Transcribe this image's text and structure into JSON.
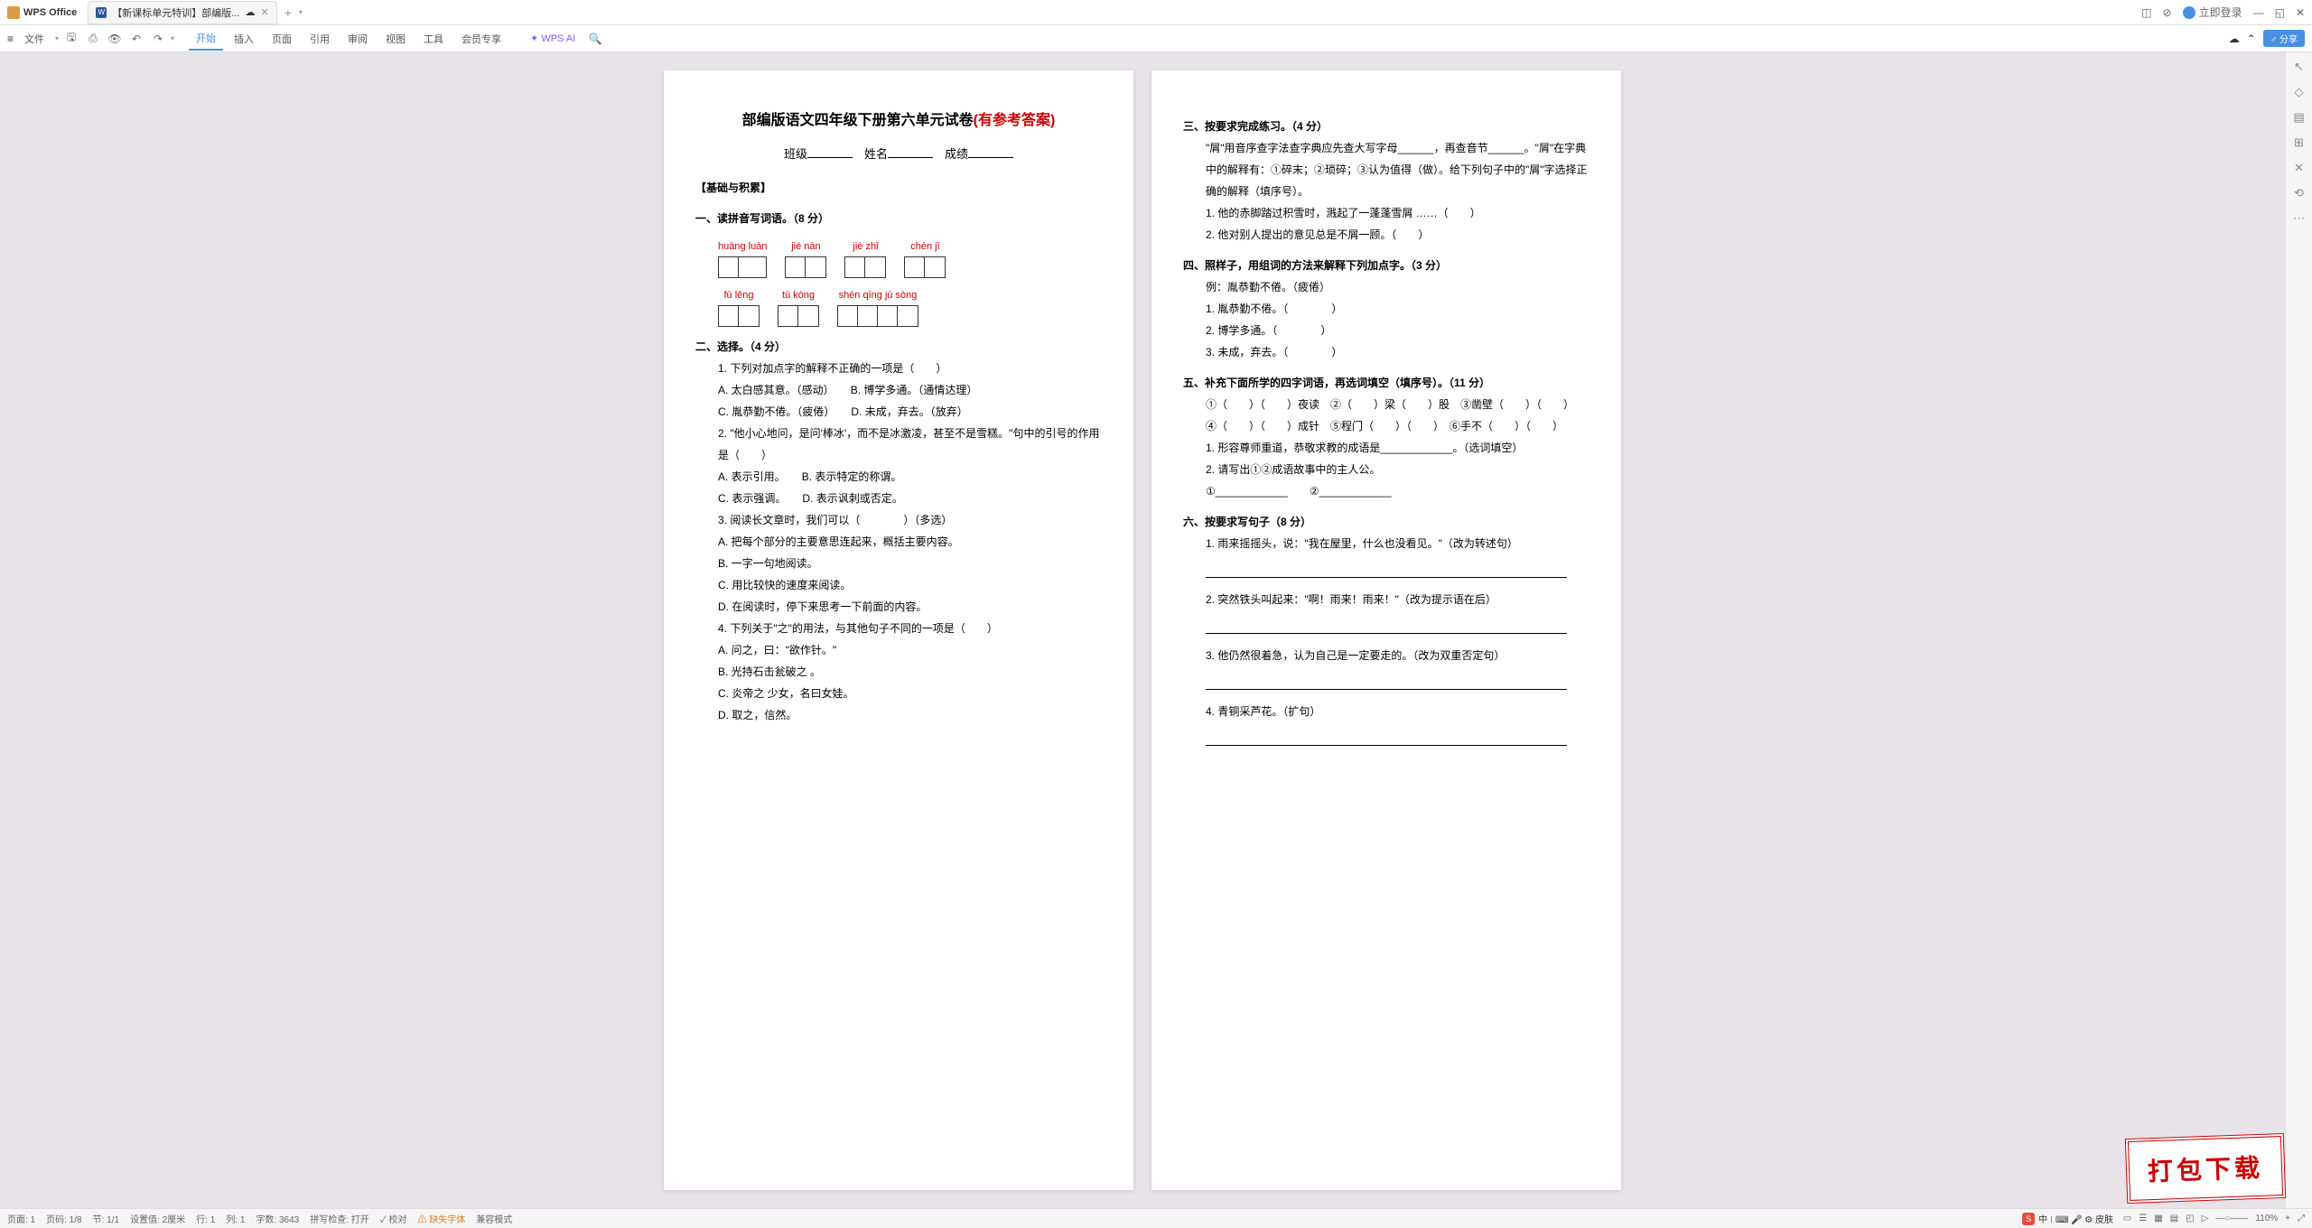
{
  "titlebar": {
    "app": "WPS Office",
    "tab": "【新课标单元特训】部编版...",
    "login": "立即登录"
  },
  "menu": {
    "file": "文件",
    "items": [
      "开始",
      "插入",
      "页面",
      "引用",
      "审阅",
      "视图",
      "工具",
      "会员专享"
    ],
    "ai": "WPS AI"
  },
  "doc": {
    "title_main": "部编版语文四年级下册第六单元试卷",
    "title_red": "(有参考答案)",
    "sub_class": "班级",
    "sub_name": "姓名",
    "sub_score": "成绩",
    "section_basis": "【基础与积累】",
    "q1": "一、读拼音写词语。（8 分）",
    "pinyin": [
      [
        "huāng luàn",
        "jié nàn",
        "jiè zhǐ",
        "chèn jī"
      ],
      [
        "fū lěng",
        "tū kòng",
        "shén qīng jù sòng"
      ]
    ],
    "q2": "二、选择。（4 分）",
    "q2_1": "1. 下列对加点字的解释不正确的一项是（　　）",
    "q2_1a": "A. 太白感其意。（感动）",
    "q2_1b": "B. 博学多通。（通情达理）",
    "q2_1c": "C. 胤恭勤不倦。（疲倦）",
    "q2_1d": "D. 未成，弃去。（放弃）",
    "q2_2": "2. \"他小心地问，是问'棒冰'，而不是冰激凌，甚至不是雪糕。\"句中的引号的作用是（　　）",
    "q2_2a": "A. 表示引用。",
    "q2_2b": "B. 表示特定的称谓。",
    "q2_2c": "C. 表示强调。",
    "q2_2d": "D. 表示讽刺或否定。",
    "q2_3": "3. 阅读长文章时，我们可以（　　　　）（多选）",
    "q2_3a": "A. 把每个部分的主要意思连起来，概括主要内容。",
    "q2_3b": "B. 一字一句地阅读。",
    "q2_3c": "C. 用比较快的速度来阅读。",
    "q2_3d": "D. 在阅读时，停下来思考一下前面的内容。",
    "q2_4": "4. 下列关于\"之\"的用法，与其他句子不同的一项是（　　）",
    "q2_4a": "A. 问之，曰：\"欲作针。\"",
    "q2_4b": "B. 光持石击瓮破之 。",
    "q2_4c": "C. 炎帝之 少女，名曰女娃。",
    "q2_4d": "D. 取之，信然。",
    "q3": "三、按要求完成练习。（4 分）",
    "q3_text": "\"屑\"用音序查字法查字典应先查大写字母______，再查音节______。\"屑\"在字典中的解释有：①碎末；②琐碎；③认为值得（做）。给下列句子中的\"屑\"字选择正确的解释（填序号）。",
    "q3_1": "1. 他的赤脚踏过积雪时，溅起了一蓬蓬雪屑 ……（　　）",
    "q3_2": "2. 他对别人提出的意见总是不屑一顾。（　　）",
    "q4": "四、照样子，用组词的方法来解释下列加点字。（3 分）",
    "q4_ex": "例：胤恭勤不倦。（疲倦）",
    "q4_1": "1. 胤恭勤不倦。（　　　　）",
    "q4_2": "2. 博学多通。（　　　　）",
    "q4_3": "3. 未成，弃去。（　　　　）",
    "q5": "五、补充下面所学的四字词语，再选词填空（填序号）。（11 分）",
    "q5_r1": "①（　　）（　　）夜读　②（　　）梁（　　）股　③凿壁（　　）（　　）",
    "q5_r2": "④（　　）（　　）成针　⑤程门（　　）（　　）　⑥手不（　　）（　　）",
    "q5_1": "1. 形容尊师重道，恭敬求教的成语是____________。（选词填空）",
    "q5_2": "2. 请写出①②成语故事中的主人公。",
    "q5_3": "①____________　　②____________",
    "q6": "六、按要求写句子（8 分）",
    "q6_1": "1. 雨来摇摇头，说：\"我在屋里，什么也没看见。\"（改为转述句）",
    "q6_2": "2. 突然铁头叫起来：\"啊！雨来！雨来！\"（改为提示语在后）",
    "q6_3": "3. 他仍然很着急，认为自己是一定要走的。（改为双重否定句）",
    "q6_4": "4. 青铜采芦花。（扩句）"
  },
  "status": {
    "page": "页码: 1/8",
    "sec": "节: 1/1",
    "margin": "设置值: 2厘米",
    "row": "行: 1",
    "col": "列: 1",
    "words": "字数: 3643",
    "spell": "拼写检查: 打开",
    "proof": "校对",
    "font": "缺失字体",
    "compat": "兼容模式",
    "zoom": "110%",
    "page_lbl": "页面: 1"
  },
  "stamp": "打包下载"
}
